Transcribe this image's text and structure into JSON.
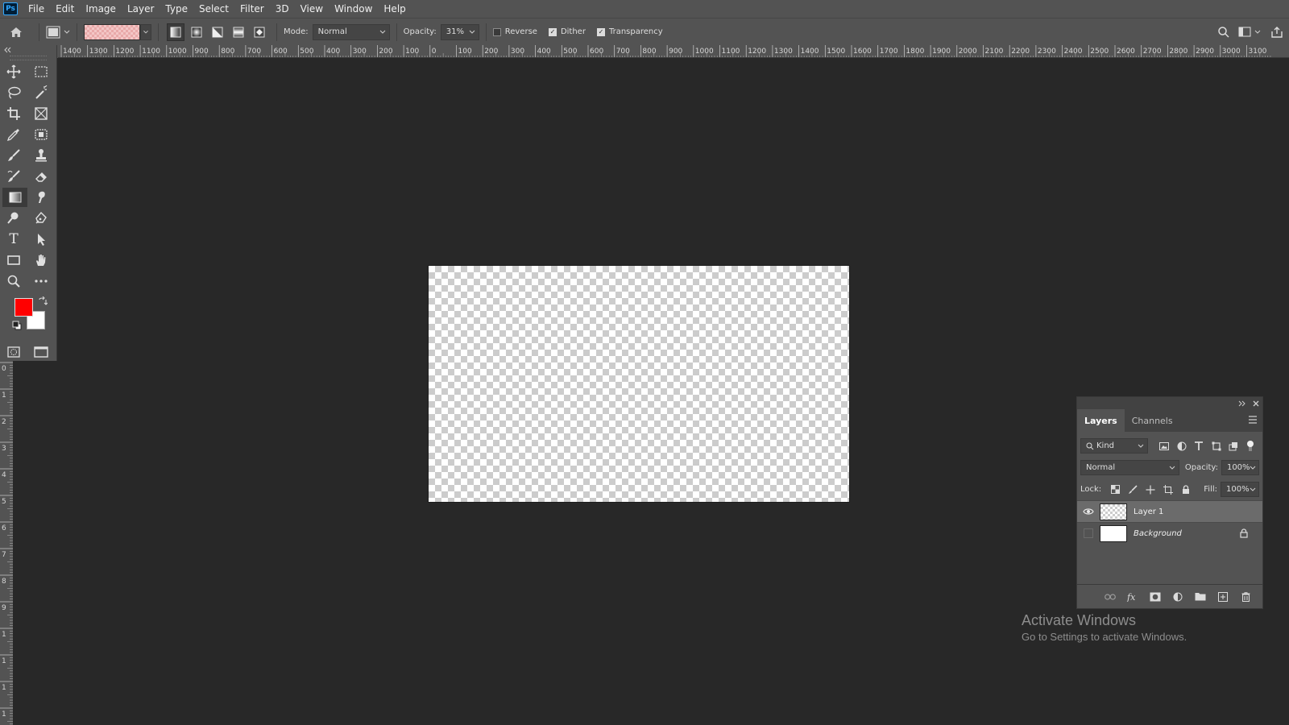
{
  "app": {
    "logo": "Ps",
    "menu": [
      "File",
      "Edit",
      "Image",
      "Layer",
      "Type",
      "Select",
      "Filter",
      "3D",
      "View",
      "Window",
      "Help"
    ]
  },
  "options_bar": {
    "mode_label": "Mode:",
    "mode_value": "Normal",
    "opacity_label": "Opacity:",
    "opacity_value": "31%",
    "reverse_label": "Reverse",
    "reverse_checked": false,
    "dither_label": "Dither",
    "dither_checked": true,
    "transparency_label": "Transparency",
    "transparency_checked": true,
    "gradient_types": [
      "linear-gradient-icon",
      "radial-gradient-icon",
      "angle-gradient-icon",
      "reflected-gradient-icon",
      "diamond-gradient-icon"
    ],
    "active_gradient_type": "linear-gradient-icon"
  },
  "rulers": {
    "top_labels": [
      "1400",
      "1300",
      "1200",
      "1100",
      "1000",
      "900",
      "800",
      "700",
      "600",
      "500",
      "400",
      "300",
      "200",
      "100",
      "0",
      "100",
      "200",
      "300",
      "400",
      "500",
      "600",
      "700",
      "800",
      "900",
      "1000",
      "1100",
      "1200",
      "1300",
      "1400",
      "1500",
      "1600",
      "1700",
      "1800",
      "1900",
      "2000",
      "2100",
      "2200",
      "2300",
      "2400",
      "2500",
      "2600",
      "2700",
      "2800",
      "2900",
      "3000",
      "3100"
    ],
    "left_labels": [
      "0",
      "1",
      "2",
      "3",
      "4",
      "5",
      "6",
      "7",
      "8",
      "9",
      "1",
      "1",
      "1",
      "1"
    ]
  },
  "toolbar": {
    "tools": [
      [
        "move-tool-icon",
        "marquee-tool-icon"
      ],
      [
        "lasso-tool-icon",
        "magic-wand-tool-icon"
      ],
      [
        "crop-tool-icon",
        "frame-tool-icon"
      ],
      [
        "eyedropper-tool-icon",
        "healing-brush-tool-icon"
      ],
      [
        "brush-tool-icon",
        "clone-stamp-tool-icon"
      ],
      [
        "history-brush-tool-icon",
        "eraser-tool-icon"
      ],
      [
        "gradient-tool-icon",
        "smudge-tool-icon"
      ],
      [
        "dodge-tool-icon",
        "pen-tool-icon"
      ],
      [
        "type-tool-icon",
        "path-selection-tool-icon"
      ],
      [
        "rectangle-tool-icon",
        "hand-tool-icon"
      ],
      [
        "zoom-tool-icon",
        "more-tools-icon"
      ]
    ],
    "active_tool": "gradient-tool-icon",
    "type_glyph": "T"
  },
  "colors": {
    "foreground": "#ff0000",
    "background": "#ffffff",
    "accent": "#31a8ff"
  },
  "layers_panel": {
    "tabs": [
      "Layers",
      "Channels"
    ],
    "active_tab": "Layers",
    "filter_value": "Kind",
    "blend_mode": "Normal",
    "opacity_label": "Opacity:",
    "opacity_value": "100%",
    "lock_label": "Lock:",
    "fill_label": "Fill:",
    "fill_value": "100%",
    "layers": [
      {
        "name": "Layer 1",
        "visible": true,
        "selected": true,
        "thumb": "checker",
        "locked": false
      },
      {
        "name": "Background",
        "visible": false,
        "selected": false,
        "thumb": "white",
        "locked": true
      }
    ]
  },
  "watermark": {
    "title": "Activate Windows",
    "subtitle": "Go to Settings to activate Windows."
  }
}
